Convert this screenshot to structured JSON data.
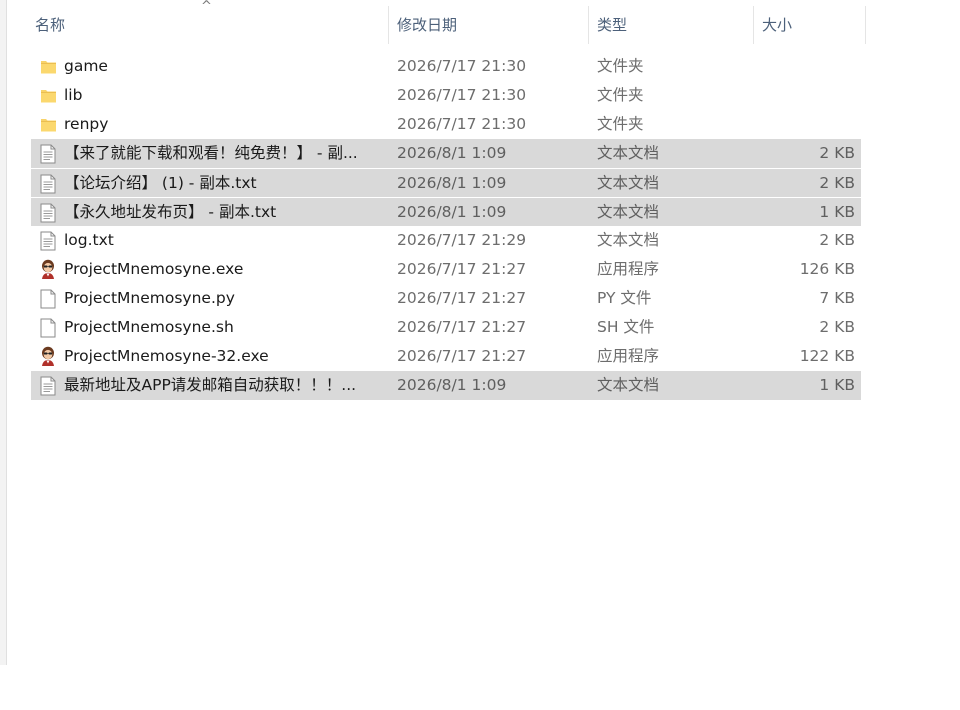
{
  "columns": {
    "name": "名称",
    "date": "修改日期",
    "type": "类型",
    "size": "大小",
    "sort_indicator": "^"
  },
  "files": [
    {
      "name": "game",
      "date": "2026/7/17 21:30",
      "type": "文件夹",
      "size": "",
      "icon": "folder-icon",
      "selected": false
    },
    {
      "name": "lib",
      "date": "2026/7/17 21:30",
      "type": "文件夹",
      "size": "",
      "icon": "folder-icon",
      "selected": false
    },
    {
      "name": "renpy",
      "date": "2026/7/17 21:30",
      "type": "文件夹",
      "size": "",
      "icon": "folder-icon",
      "selected": false
    },
    {
      "name": "【来了就能下载和观看！纯免费！】 - 副...",
      "date": "2026/8/1 1:09",
      "type": "文本文档",
      "size": "2 KB",
      "icon": "text-document-icon",
      "selected": true
    },
    {
      "name": "【论坛介绍】 (1) - 副本.txt",
      "date": "2026/8/1 1:09",
      "type": "文本文档",
      "size": "2 KB",
      "icon": "text-document-icon",
      "selected": true
    },
    {
      "name": "【永久地址发布页】 - 副本.txt",
      "date": "2026/8/1 1:09",
      "type": "文本文档",
      "size": "1 KB",
      "icon": "text-document-icon",
      "selected": true
    },
    {
      "name": "log.txt",
      "date": "2026/7/17 21:29",
      "type": "文本文档",
      "size": "2 KB",
      "icon": "text-document-icon",
      "selected": false
    },
    {
      "name": "ProjectMnemosyne.exe",
      "date": "2026/7/17 21:27",
      "type": "应用程序",
      "size": "126 KB",
      "icon": "application-icon",
      "selected": false
    },
    {
      "name": "ProjectMnemosyne.py",
      "date": "2026/7/17 21:27",
      "type": "PY 文件",
      "size": "7 KB",
      "icon": "blank-file-icon",
      "selected": false
    },
    {
      "name": "ProjectMnemosyne.sh",
      "date": "2026/7/17 21:27",
      "type": "SH 文件",
      "size": "2 KB",
      "icon": "blank-file-icon",
      "selected": false
    },
    {
      "name": "ProjectMnemosyne-32.exe",
      "date": "2026/7/17 21:27",
      "type": "应用程序",
      "size": "122 KB",
      "icon": "application-icon",
      "selected": false
    },
    {
      "name": "最新地址及APP请发邮箱自动获取！！！...",
      "date": "2026/8/1 1:09",
      "type": "文本文档",
      "size": "1 KB",
      "icon": "text-document-icon",
      "selected": true
    }
  ]
}
